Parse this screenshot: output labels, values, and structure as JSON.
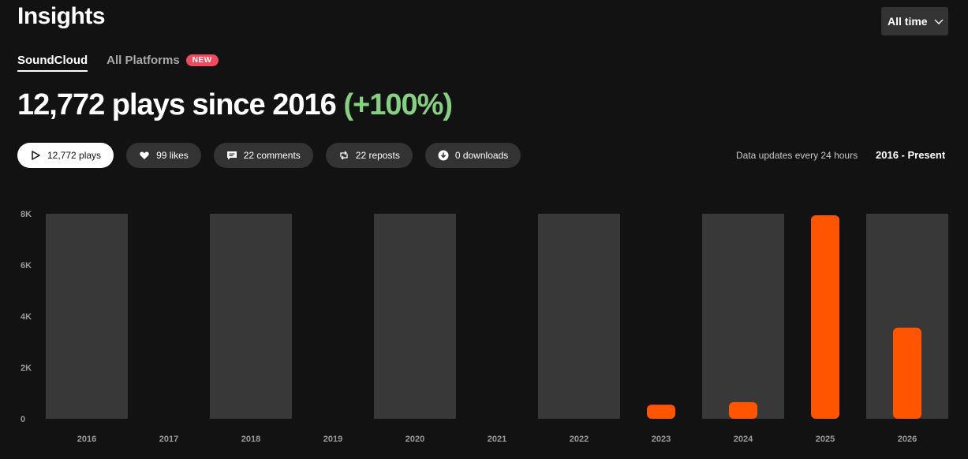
{
  "header": {
    "title": "Insights",
    "timeframe_label": "All time"
  },
  "tabs": [
    {
      "label": "SoundCloud",
      "active": true
    },
    {
      "label": "All Platforms",
      "active": false,
      "badge": "NEW"
    }
  ],
  "summary": {
    "headline": "12,772 plays since 2016",
    "change": "(+100%)"
  },
  "metrics": [
    {
      "label": "12,772 plays",
      "icon": "play-icon",
      "active": true
    },
    {
      "label": "99 likes",
      "icon": "heart-icon",
      "active": false
    },
    {
      "label": "22 comments",
      "icon": "comment-icon",
      "active": false
    },
    {
      "label": "22 reposts",
      "icon": "repost-icon",
      "active": false
    },
    {
      "label": "0 downloads",
      "icon": "download-icon",
      "active": false
    }
  ],
  "info": {
    "updates": "Data updates every 24 hours",
    "range": "2016 - Present"
  },
  "colors": {
    "accent": "#ff5500",
    "band": "#383838",
    "positive": "#86d082",
    "badge": "#f04a5e"
  },
  "chart_data": {
    "type": "bar",
    "categories": [
      "2016",
      "2017",
      "2018",
      "2019",
      "2020",
      "2021",
      "2022",
      "2023",
      "2024",
      "2025",
      "2026"
    ],
    "values": [
      0,
      0,
      0,
      0,
      0,
      0,
      0,
      550,
      650,
      8000,
      3550
    ],
    "ylim": [
      0,
      8000
    ],
    "yticks": [
      0,
      2000,
      4000,
      6000,
      8000
    ],
    "ytick_labels": [
      "0",
      "2K",
      "4K",
      "6K",
      "8K"
    ],
    "grid": false,
    "alternating_bands": true
  }
}
